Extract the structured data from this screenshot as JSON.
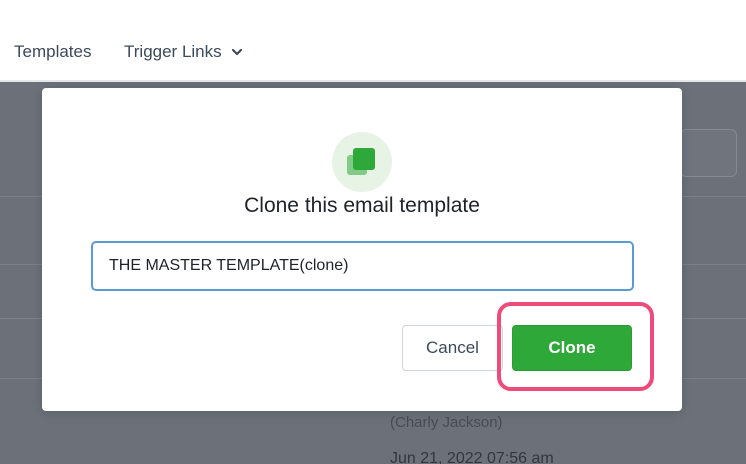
{
  "nav": {
    "templates_label": "Templates",
    "trigger_links_label": "Trigger Links"
  },
  "background": {
    "author_text": "(Charly Jackson)",
    "date_text": "Jun 21, 2022 07:56 am"
  },
  "modal": {
    "icon": "clone-icon",
    "title": "Clone this email template",
    "input_value": "THE MASTER TEMPLATE(clone)",
    "cancel_label": "Cancel",
    "clone_label": "Clone"
  },
  "colors": {
    "accent_green": "#2fa83a",
    "highlight_pink": "#ee4a7a",
    "input_focus_blue": "#5a9bd5"
  }
}
